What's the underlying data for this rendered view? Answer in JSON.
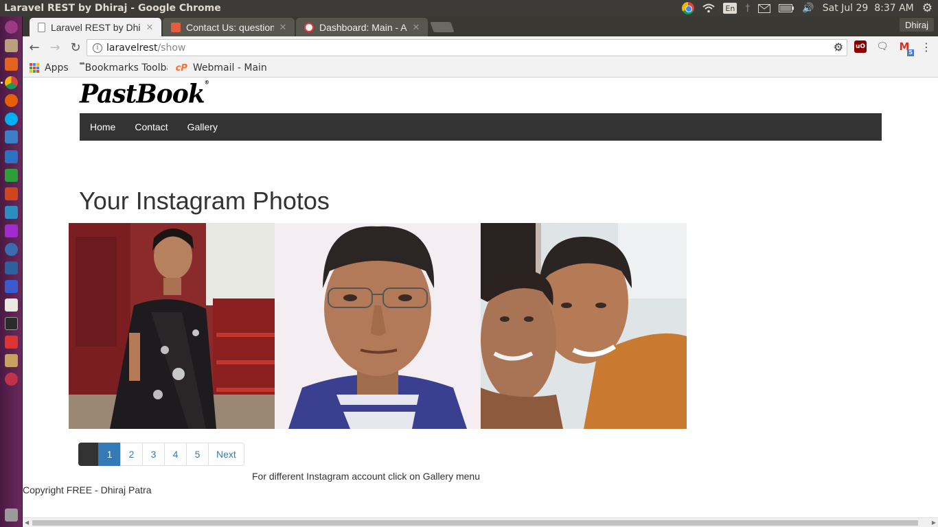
{
  "window": {
    "title": "Laravel REST by Dhiraj - Google Chrome",
    "clock": "Sat Jul 29  8:37 AM",
    "keyboard": "En"
  },
  "tabs": [
    {
      "label": "Laravel REST by Dhiraj",
      "active": true
    },
    {
      "label": "Contact Us: questions",
      "active": false
    },
    {
      "label": "Dashboard: Main - Activity",
      "active": false
    }
  ],
  "profile": {
    "name": "Dhiraj"
  },
  "omnibox": {
    "host": "laravelrest",
    "path": "/show"
  },
  "extensions": {
    "ublock": "uO",
    "gmail_count": "5"
  },
  "bookmarks": [
    {
      "label": "Apps"
    },
    {
      "label": "Bookmarks Toolbar"
    },
    {
      "label": "Webmail - Main"
    }
  ],
  "site": {
    "logo": "PastBook",
    "nav": [
      "Home",
      "Contact",
      "Gallery"
    ],
    "heading": "Your Instagram Photos",
    "pagination": {
      "pages": [
        "1",
        "2",
        "3",
        "4",
        "5"
      ],
      "next": "Next",
      "current": "1"
    },
    "note": "For different Instagram account click on Gallery menu",
    "copyright": "Copyright FREE - Dhiraj Patra"
  },
  "colors": {
    "navbar": "#333333",
    "pagination_active": "#337ab7",
    "launcher": "#5b1f4e"
  }
}
